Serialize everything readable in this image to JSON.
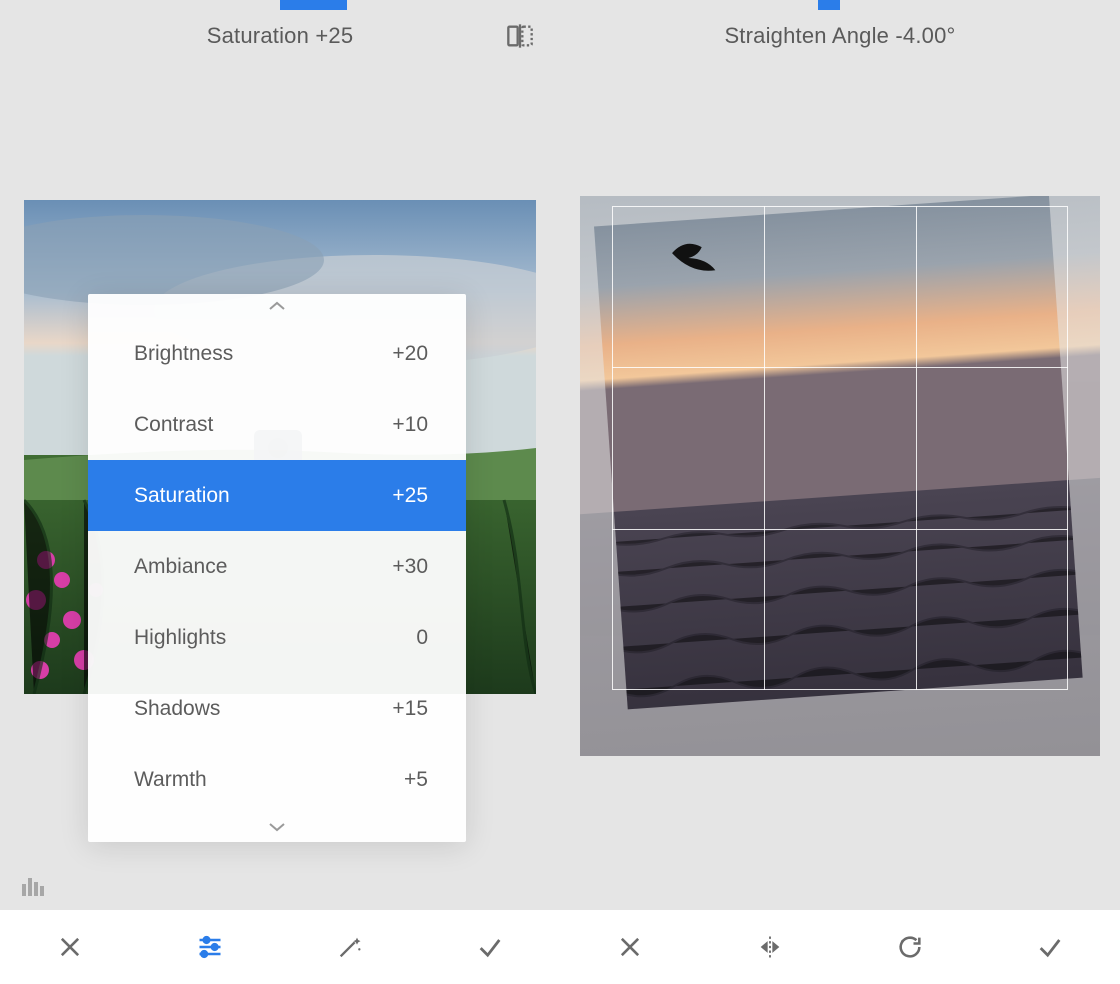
{
  "left": {
    "header_label": "Saturation +25",
    "slider_start_pct": 50,
    "slider_width_pct": 12,
    "popup": {
      "items": [
        {
          "label": "Brightness",
          "value": "+20",
          "selected": false
        },
        {
          "label": "Contrast",
          "value": "+10",
          "selected": false
        },
        {
          "label": "Saturation",
          "value": "+25",
          "selected": true
        },
        {
          "label": "Ambiance",
          "value": "+30",
          "selected": false
        },
        {
          "label": "Highlights",
          "value": "0",
          "selected": false
        },
        {
          "label": "Shadows",
          "value": "+15",
          "selected": false
        },
        {
          "label": "Warmth",
          "value": "+5",
          "selected": false
        }
      ]
    },
    "bottom_icons": [
      "close",
      "sliders",
      "wand",
      "check"
    ],
    "active_bottom_index": 1
  },
  "right": {
    "header_label": "Straighten Angle -4.00°",
    "slider_start_pct": 46,
    "slider_width_pct": 4,
    "rotation_deg": -4,
    "bottom_icons": [
      "close",
      "flip",
      "rotate",
      "check"
    ]
  },
  "colors": {
    "accent": "#2B7DE9",
    "bg": "#E5E5E5",
    "text": "#5a5a5a"
  }
}
